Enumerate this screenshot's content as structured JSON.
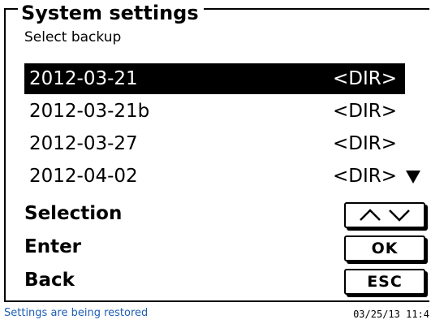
{
  "header": {
    "title": "System settings",
    "subtitle": "Select backup"
  },
  "backups": [
    {
      "date": "2012-03-21",
      "type": "<DIR>",
      "selected": true
    },
    {
      "date": "2012-03-21b",
      "type": "<DIR>",
      "selected": false
    },
    {
      "date": "2012-03-27",
      "type": "<DIR>",
      "selected": false
    },
    {
      "date": "2012-04-02",
      "type": "<DIR>",
      "selected": false
    }
  ],
  "functions": {
    "selection_label": "Selection",
    "enter_label": "Enter",
    "enter_key": "OK",
    "back_label": "Back",
    "back_key": "ESC"
  },
  "status_bar": {
    "message": "Settings are being restored",
    "datetime": "03/25/13 11:4",
    "message_color": "#1e5fb4"
  },
  "icons": {
    "scroll": "triangle-down-icon",
    "selection_keys": [
      "arrow-up-icon",
      "arrow-down-icon"
    ]
  }
}
